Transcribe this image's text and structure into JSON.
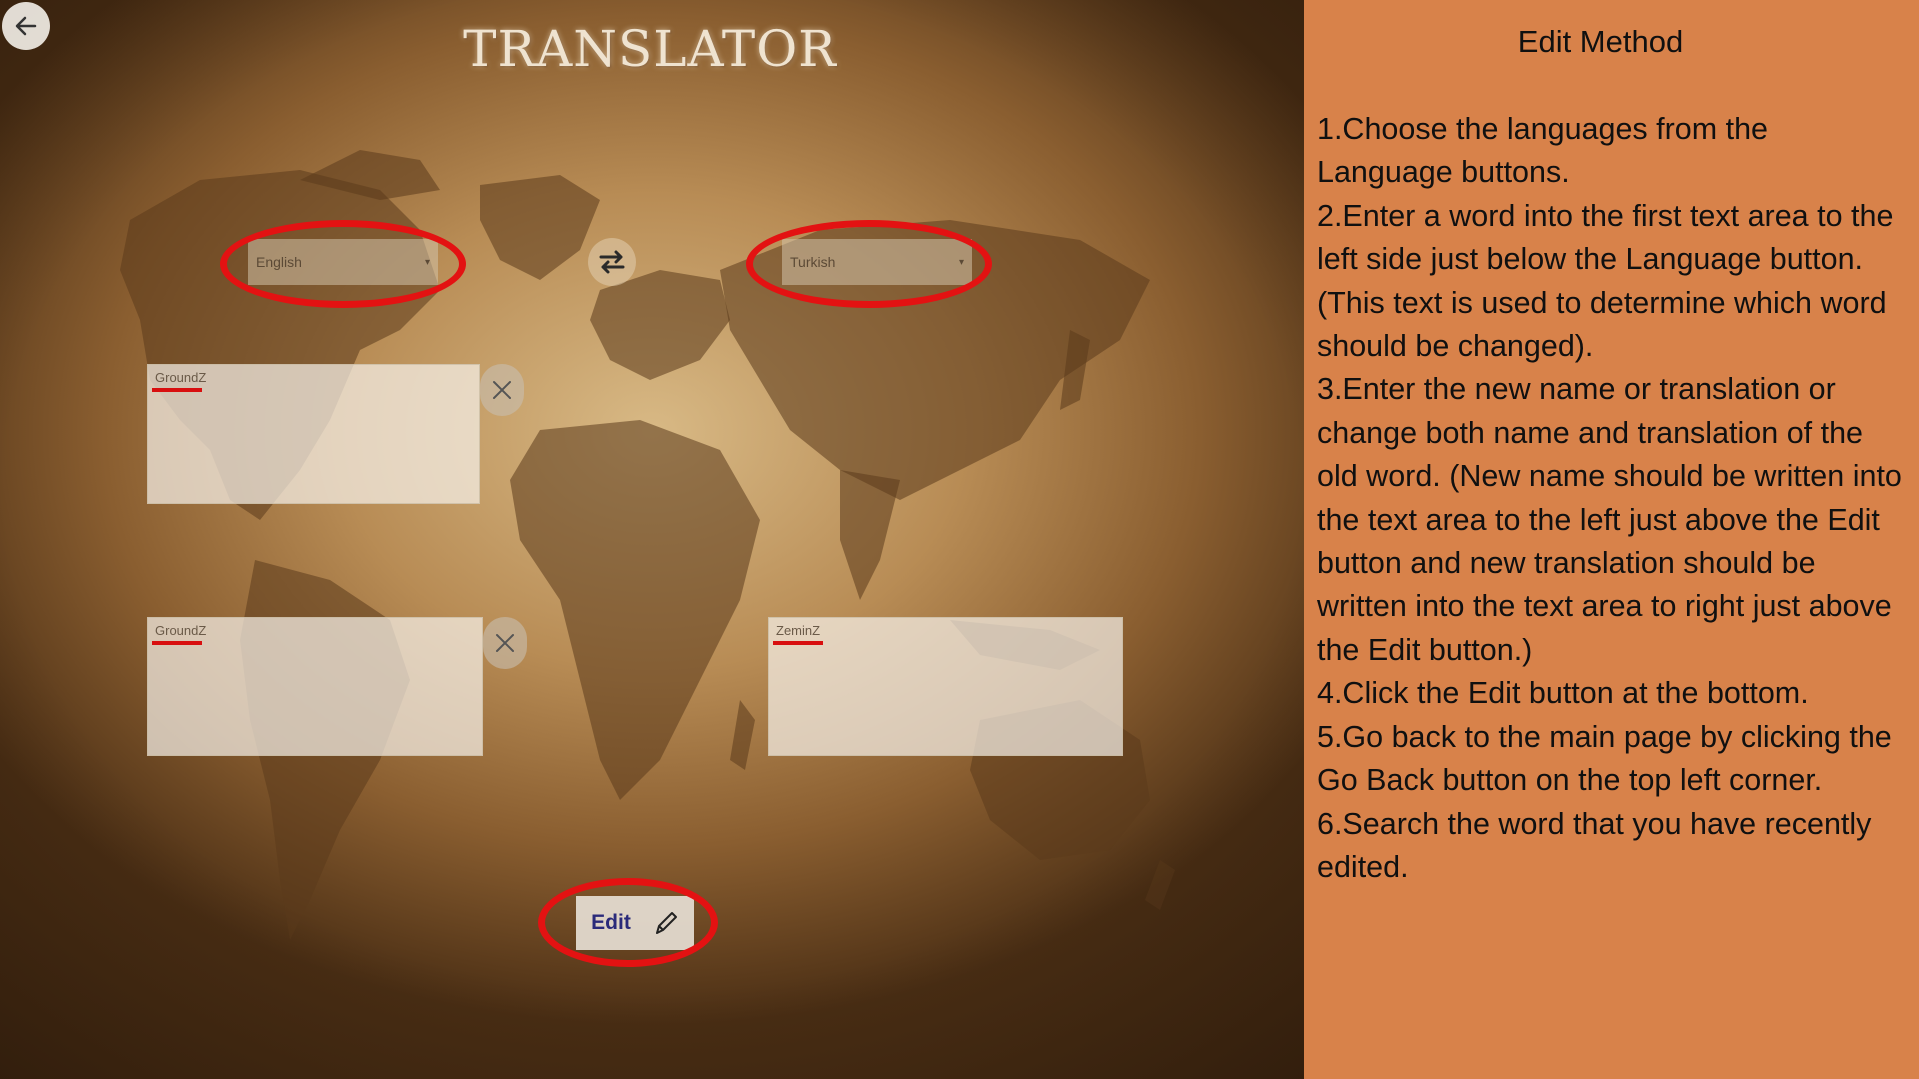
{
  "app": {
    "title": "TRANSLATOR",
    "back_icon": "arrow-left-icon",
    "source_language": "English",
    "target_language": "Turkish",
    "swap_icon": "swap-arrows-icon",
    "old_word_value": "GroundZ",
    "new_name_value": "GroundZ",
    "new_translation_value": "ZeminZ",
    "clear_icon": "close-x-icon",
    "edit_label": "Edit",
    "edit_icon": "pencil-icon",
    "highlight_color": "#e31212"
  },
  "panel": {
    "heading": "Edit Method",
    "background": "#d8824a",
    "steps": [
      "1.Choose the languages from the Language buttons.",
      "2.Enter a word into the first text area to the left side just below the Language button. (This text is used to determine which word should be changed).",
      "3.Enter the new name or translation or change both name and translation of the old word. (New name should be written into the text area to the left just above the Edit button and new translation should be written into the text area to right just above the Edit button.)",
      "4.Click the Edit button at the bottom.",
      "5.Go back to the main page by clicking the Go Back button on the top left corner.",
      "6.Search the word that you have recently edited."
    ]
  }
}
